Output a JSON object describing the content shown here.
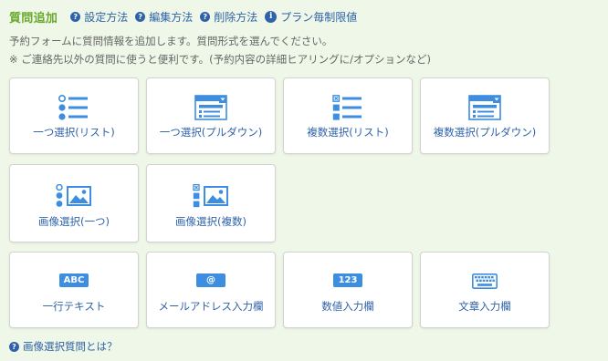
{
  "header": {
    "title": "質問追加",
    "links": [
      {
        "label": "設定方法"
      },
      {
        "label": "編集方法"
      },
      {
        "label": "削除方法"
      },
      {
        "label": "プラン毎制限値"
      }
    ],
    "help_glyph": "?",
    "info_glyph": "i"
  },
  "description": {
    "line1": "予約フォームに質問情報を追加します。質問形式を選んでください。",
    "line2": "※ ご連絡先以外の質問に使うと便利です。(予約内容の詳細ヒアリングに/オプションなど)"
  },
  "question_types": [
    {
      "label": "一つ選択(リスト)",
      "icon": "radio-list-icon"
    },
    {
      "label": "一つ選択(プルダウン)",
      "icon": "dropdown-window-icon"
    },
    {
      "label": "複数選択(リスト)",
      "icon": "checkbox-list-icon"
    },
    {
      "label": "複数選択(プルダウン)",
      "icon": "dropdown-window-icon"
    },
    {
      "label": "画像選択(一つ)",
      "icon": "radio-image-icon"
    },
    {
      "label": "画像選択(複数)",
      "icon": "checkbox-image-icon"
    },
    {
      "label": "一行テキスト",
      "icon": "text-badge-icon",
      "badge": "ABC"
    },
    {
      "label": "メールアドレス入力欄",
      "icon": "email-badge-icon",
      "badge": "@"
    },
    {
      "label": "数値入力欄",
      "icon": "number-badge-icon",
      "badge": "123"
    },
    {
      "label": "文章入力欄",
      "icon": "keyboard-icon"
    }
  ],
  "footer": {
    "label": "画像選択質問とは？"
  },
  "colors": {
    "background": "#eef7e8",
    "title_green": "#6aaa2c",
    "link_blue": "#2f62a8",
    "icon_blue": "#3d8ee0",
    "card_border": "#d3d3d3"
  }
}
